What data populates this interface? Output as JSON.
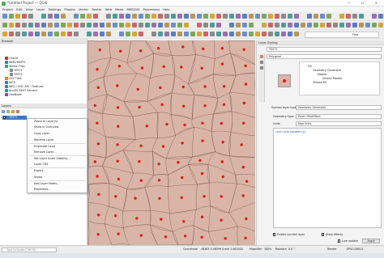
{
  "window": {
    "title": "*Untitled Project — QGIS",
    "controls": [
      "—",
      "☐",
      "✕"
    ]
  },
  "menu": [
    "Project",
    "Edit",
    "View",
    "Layer",
    "Settings",
    "Plugins",
    "Vector",
    "Raster",
    "Web",
    "Mesh",
    "MMQGIS",
    "Processing",
    "Help"
  ],
  "find": {
    "label": "Find"
  },
  "browser": {
    "title": "Browser",
    "items": [
      "Oracle",
      "WMS/WMTS",
      "Vector Tiles",
      "TEST1",
      "TEST2",
      "XYZ Tiles",
      "WCS",
      "WFS / OGC API - Features",
      "ArcGIS REST Servers",
      "GeoNode"
    ]
  },
  "layers": {
    "title": "Layers",
    "layer_name": "TEST1"
  },
  "context_menu": [
    "Zoom to Layer(s)",
    "Show in Overview",
    "Copy Layer",
    "Rename Layer",
    "Duplicate Layer",
    "Remove Layer…",
    "Set Layer Scale Visibility…",
    "Layer CRS",
    "Export",
    "Styles",
    "Add Layer Notes…",
    "Properties…"
  ],
  "styling": {
    "title": "Layer Styling",
    "layer": "TEST1",
    "renderer": "Polygone",
    "tree": [
      "Fill",
      "Geometry Generator",
      "Marker",
      "Simple Marker",
      "Simple Fill"
    ],
    "symbol_layer_type_label": "Symbol layer type",
    "symbol_layer_type": "Geometry Generator",
    "geometry_type_label": "Geometry type",
    "geometry_type": "Point / MultiPoint",
    "units_label": "Units",
    "units": "Map Units",
    "expression": "centroid($geometry)",
    "enable_symbol_layer": "Enable symbol layer",
    "draw_effects": "Draw effects",
    "live_update": "Live update",
    "apply": "Apply"
  },
  "statusbar": {
    "locate_placeholder": "Type to locate (Ctrl+K)",
    "coordinate_label": "Coordinate",
    "coordinate": "48463.3,46599",
    "scale_label": "Scale",
    "scale": "1:461000",
    "magnifier_label": "Magnifier",
    "magnifier": "100%",
    "rotation_label": "Rotation",
    "rotation": "0.0 °",
    "render": "Render",
    "crs": "EPSG:28812"
  },
  "colors": {
    "map_fill": "#d9b5a8",
    "marker": "#e01b1b",
    "boundary": "#6b4f46"
  }
}
